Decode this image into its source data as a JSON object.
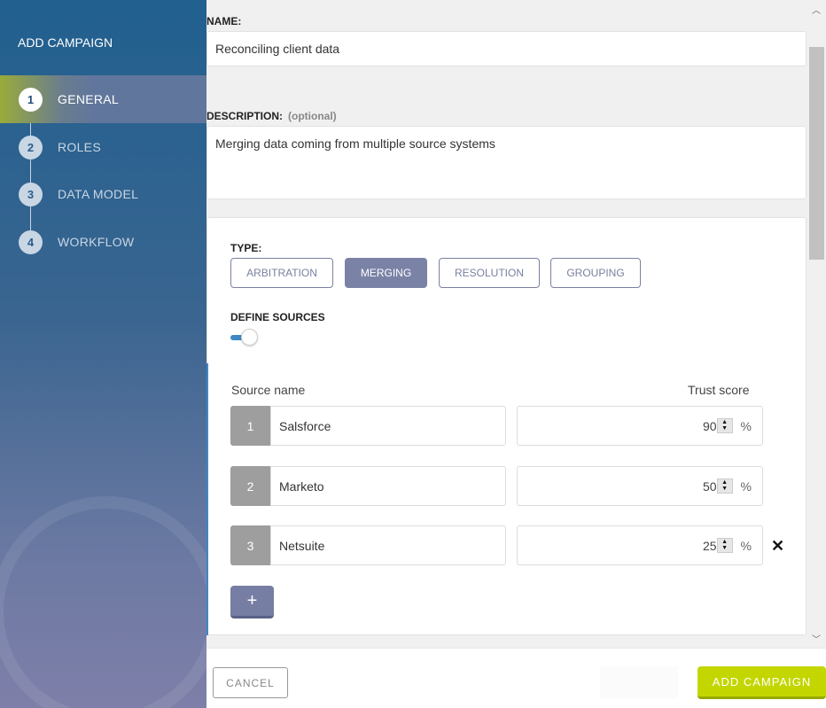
{
  "sidebar": {
    "title": "ADD CAMPAIGN",
    "steps": [
      {
        "num": "1",
        "label": "GENERAL",
        "active": true
      },
      {
        "num": "2",
        "label": "ROLES"
      },
      {
        "num": "3",
        "label": "DATA MODEL"
      },
      {
        "num": "4",
        "label": "WORKFLOW"
      }
    ]
  },
  "form": {
    "name_label": "NAME:",
    "name_value": "Reconciling client data",
    "desc_label": "DESCRIPTION:",
    "desc_optional": "(optional)",
    "desc_value": "Merging data coming from multiple source systems",
    "type_label": "TYPE:",
    "types": [
      "ARBITRATION",
      "MERGING",
      "RESOLUTION",
      "GROUPING"
    ],
    "selected_type": "MERGING",
    "define_sources_label": "DEFINE SOURCES",
    "define_sources_on": true,
    "source_name_header": "Source name",
    "trust_score_header": "Trust score",
    "sources": [
      {
        "num": "1",
        "name": "Salsforce",
        "score": "90"
      },
      {
        "num": "2",
        "name": "Marketo",
        "score": "50"
      },
      {
        "num": "3",
        "name": "Netsuite",
        "score": "25"
      }
    ],
    "percent": "%",
    "add_label": "+",
    "remove_label": "✕"
  },
  "footer": {
    "cancel": "CANCEL",
    "add_campaign": "ADD CAMPAIGN"
  },
  "colors": {
    "accent": "#c4d600",
    "selected": "#7a82a6",
    "sidebar": "#21608f"
  }
}
